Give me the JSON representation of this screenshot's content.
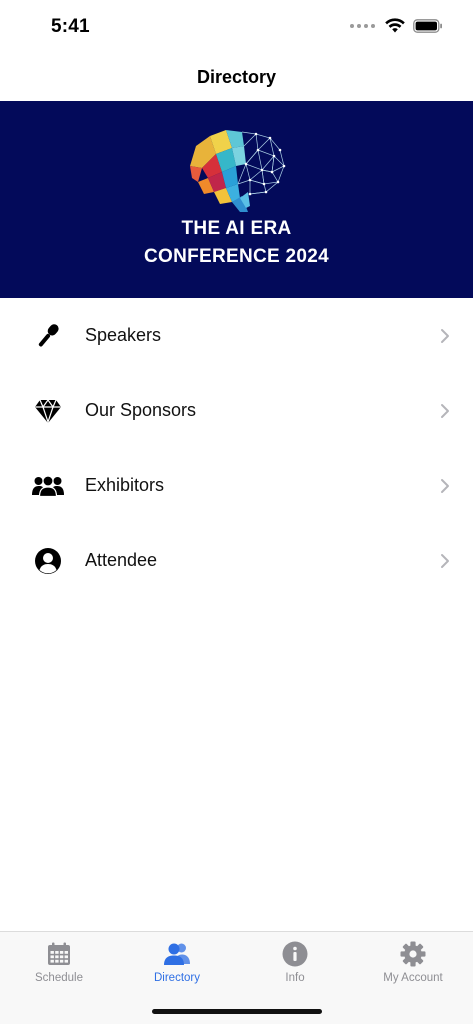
{
  "status_bar": {
    "time": "5:41",
    "icons": [
      "signal-dots-icon",
      "wifi-icon",
      "battery-icon"
    ]
  },
  "header": {
    "title": "Directory"
  },
  "banner": {
    "logo": "ai-brain-logo",
    "line1": "THE AI ERA",
    "line2": "CONFERENCE 2024",
    "background_color": "#030a5a"
  },
  "directory": {
    "items": [
      {
        "label": "Speakers",
        "icon": "microphone-icon"
      },
      {
        "label": "Our Sponsors",
        "icon": "diamond-icon"
      },
      {
        "label": "Exhibitors",
        "icon": "group-icon"
      },
      {
        "label": "Attendee",
        "icon": "user-circle-icon"
      }
    ]
  },
  "tab_bar": {
    "active_tab": "Directory",
    "active_color": "#2f6fe4",
    "inactive_color": "#8e8e93",
    "tabs": [
      {
        "label": "Schedule",
        "icon": "calendar-icon"
      },
      {
        "label": "Directory",
        "icon": "users-icon"
      },
      {
        "label": "Info",
        "icon": "info-icon"
      },
      {
        "label": "My Account",
        "icon": "gear-icon"
      }
    ]
  }
}
